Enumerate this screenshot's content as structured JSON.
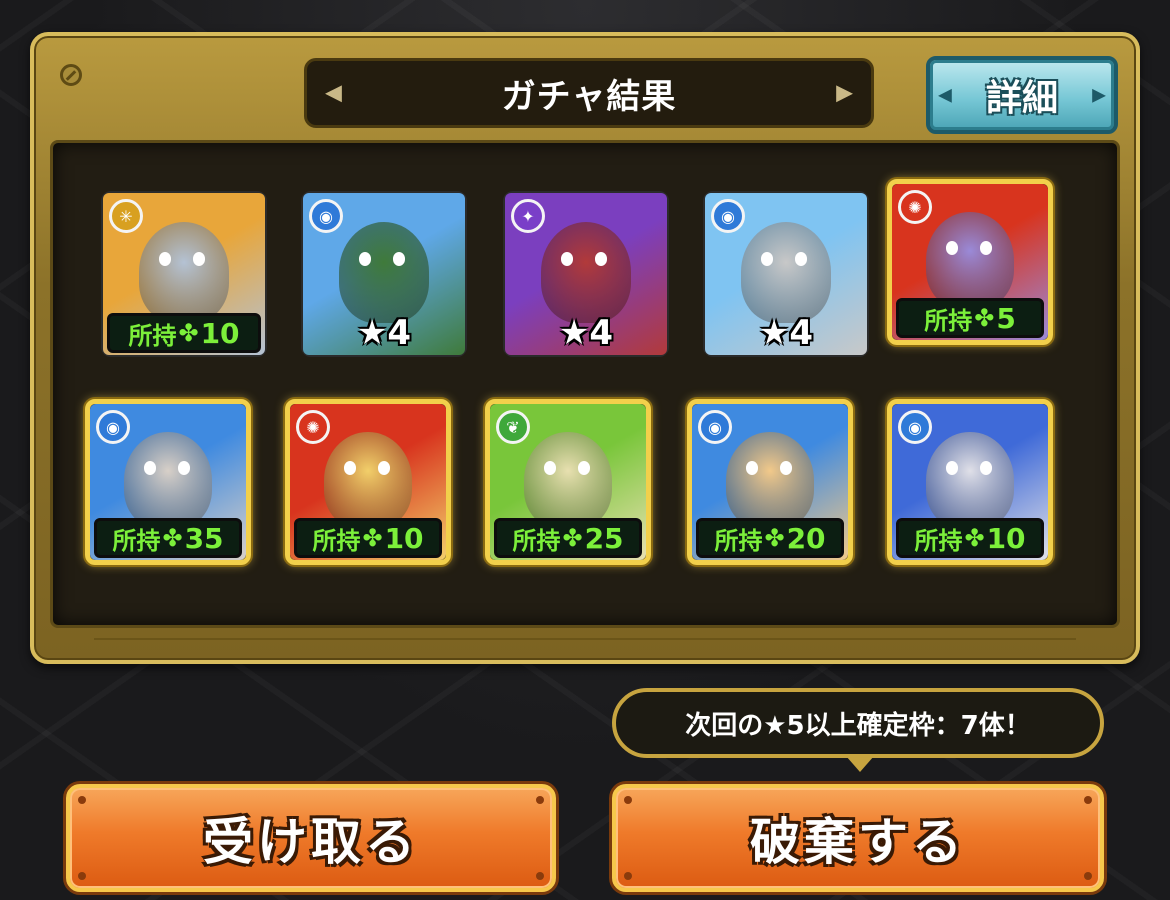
{
  "header": {
    "title": "ガチャ結果",
    "arrow_left": "◀",
    "arrow_right": "▶",
    "detail_label": "詳細"
  },
  "owned_label": "所持",
  "clover_symbol": "✤",
  "cards": [
    {
      "element": "light",
      "element_symbol": "✳",
      "status": "owned",
      "count": "10",
      "frame": "plain",
      "color_a": "#e8a63a",
      "color_b": "#b4c2d4"
    },
    {
      "element": "water",
      "element_symbol": "◉",
      "status": "rarity",
      "rarity": "★4",
      "frame": "plain",
      "color_a": "#5fa8e8",
      "color_b": "#3f7a3a"
    },
    {
      "element": "dark",
      "element_symbol": "✦",
      "status": "rarity",
      "rarity": "★4",
      "frame": "plain",
      "color_a": "#7b3fbf",
      "color_b": "#b23a3a"
    },
    {
      "element": "water",
      "element_symbol": "◉",
      "status": "rarity",
      "rarity": "★4",
      "frame": "plain",
      "color_a": "#7fc4f2",
      "color_b": "#c8c8c8"
    },
    {
      "element": "fire",
      "element_symbol": "✺",
      "status": "owned",
      "count": "5",
      "frame": "gold",
      "color_a": "#d8341e",
      "color_b": "#9a8ad8"
    },
    {
      "element": "water",
      "element_symbol": "◉",
      "status": "owned",
      "count": "35",
      "frame": "gold",
      "color_a": "#3f8ae0",
      "color_b": "#d8d0c8"
    },
    {
      "element": "fire",
      "element_symbol": "✺",
      "status": "owned",
      "count": "10",
      "frame": "gold",
      "color_a": "#d8341e",
      "color_b": "#f2cf6a"
    },
    {
      "element": "wood",
      "element_symbol": "❦",
      "status": "owned",
      "count": "25",
      "frame": "gold",
      "color_a": "#79c63a",
      "color_b": "#e8e0b0"
    },
    {
      "element": "water",
      "element_symbol": "◉",
      "status": "owned",
      "count": "20",
      "frame": "gold",
      "color_a": "#3f8ae0",
      "color_b": "#f2c98a"
    },
    {
      "element": "water",
      "element_symbol": "◉",
      "status": "owned",
      "count": "10",
      "frame": "gold",
      "color_a": "#3f6ad8",
      "color_b": "#e0e0e8"
    }
  ],
  "guarantee_text": "次回の★5以上確定枠：7体！",
  "buttons": {
    "receive": "受け取る",
    "discard": "破棄する"
  },
  "colors": {
    "owned_text": "#7cf03a",
    "panel_gold": "#b99a3f",
    "button_orange": "#ef7a2a",
    "detail_teal": "#78c8d6",
    "element_light": "#d8a020",
    "element_water": "#2f7ad8",
    "element_dark": "#7a3fc8",
    "element_fire": "#d8341e",
    "element_wood": "#3fa83a"
  }
}
